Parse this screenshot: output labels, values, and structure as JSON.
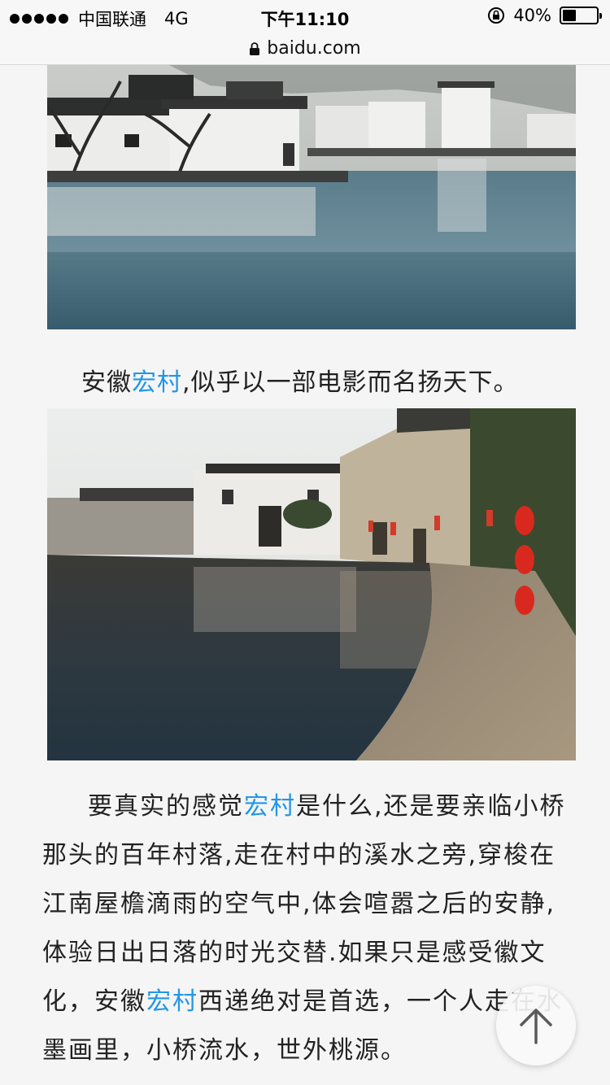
{
  "status_bar": {
    "carrier": "中国联通",
    "network": "4G",
    "time": "下午11:10",
    "battery_percent_label": "40%",
    "battery_level": 0.4
  },
  "url_bar": {
    "domain": "baidu.com"
  },
  "article": {
    "caption": {
      "prefix": "安徽",
      "link": "宏村",
      "suffix": ",似乎以一部电影而名扬天下。"
    },
    "paragraph": {
      "line1_prefix": "要真实的感觉",
      "line1_link": "宏村",
      "line1_suffix": "是什么,还是要亲临小桥",
      "line2": "那头的百年村落,走在村中的溪水之旁,穿梭在",
      "line3": "江南屋檐滴雨的空气中,体会喧嚣之后的安静,",
      "line4": "体验日出日落的时光交替.如果只是感受徽文",
      "line5_prefix": "化，安徽",
      "line5_link": "宏村",
      "line5_suffix": "西递绝对是首选，一个人走在水",
      "line6": "墨画里，小桥流水，世外桃源。"
    }
  },
  "colors": {
    "link": "#2196e6",
    "background": "#f5f5f5"
  },
  "icons": {
    "back_to_top": "arrow-up-icon",
    "secure": "lock-icon",
    "orientation_lock": "rotation-lock-icon"
  }
}
